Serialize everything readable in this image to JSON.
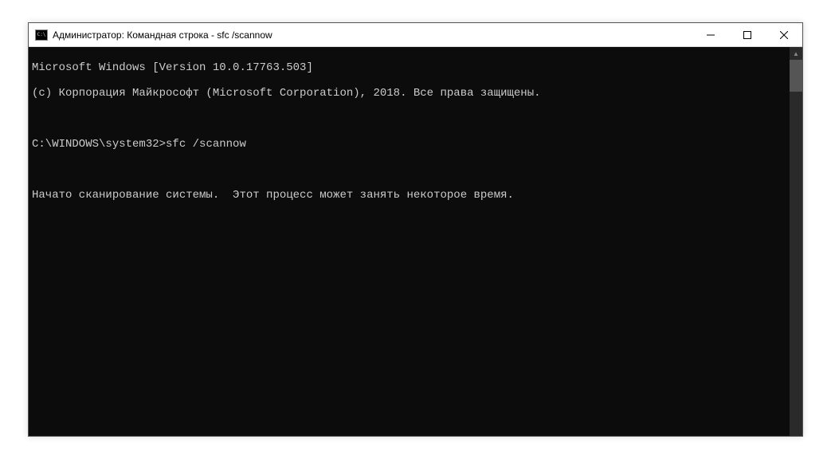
{
  "window": {
    "title": "Администратор: Командная строка - sfc  /scannow"
  },
  "terminal": {
    "line1": "Microsoft Windows [Version 10.0.17763.503]",
    "line2": "(c) Корпорация Майкрософт (Microsoft Corporation), 2018. Все права защищены.",
    "prompt": "C:\\WINDOWS\\system32>",
    "command": "sfc /scannow",
    "status": "Начато сканирование системы.  Этот процесс может занять некоторое время."
  }
}
